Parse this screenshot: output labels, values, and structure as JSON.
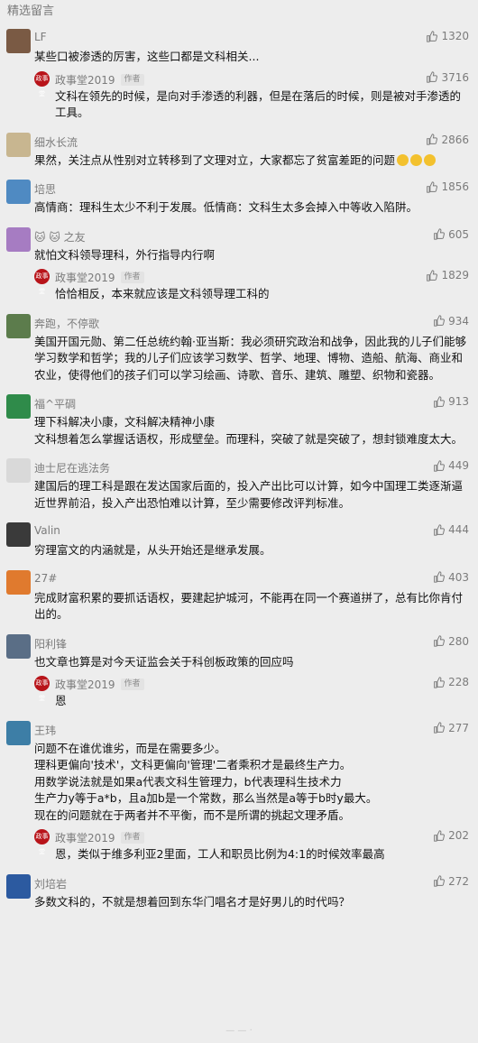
{
  "section_title": "精选留言",
  "comments": [
    {
      "nick": "LF",
      "likes": "1320",
      "text": "某些口被渗透的厉害，这些口都是文科相关...",
      "avatar_color": "#7a5a44",
      "reply": {
        "nick": "政事堂2019",
        "tag": "作者",
        "likes": "3716",
        "text": "文科在领先的时候，是向对手渗透的利器，但是在落后的时候，则是被对手渗透的工具。"
      }
    },
    {
      "nick": "细水长流",
      "likes": "2866",
      "text": "果然，关注点从性别对立转移到了文理对立，大家都忘了贫富差距的问题",
      "emojis": 3,
      "avatar_color": "#c8b690"
    },
    {
      "nick": "培思",
      "likes": "1856",
      "text": "高情商：理科生太少不利于发展。低情商：文科生太多会掉入中等收入陷阱。",
      "avatar_color": "#4f8ac2"
    },
    {
      "nick": "🐱 🐱 之友",
      "likes": "605",
      "text": "就怕文科领导理科，外行指导内行啊",
      "avatar_color": "#a67cc2",
      "reply": {
        "nick": "政事堂2019",
        "tag": "作者",
        "likes": "1829",
        "text": "恰恰相反，本来就应该是文科领导理工科的"
      }
    },
    {
      "nick": "奔跑，不停歌",
      "likes": "934",
      "text": "美国开国元勋、第二任总统约翰·亚当斯：我必须研究政治和战争，因此我的儿子们能够学习数学和哲学；我的儿子们应该学习数学、哲学、地理、博物、造船、航海、商业和农业，使得他们的孩子们可以学习绘画、诗歌、音乐、建筑、雕塑、织物和瓷器。",
      "avatar_color": "#5c7c4c"
    },
    {
      "nick": "福^平碉",
      "likes": "913",
      "text": "理下科解决小康，文科解决精神小康\n文科想着怎么掌握话语权，形成壁垒。而理科，突破了就是突破了，想封锁难度太大。",
      "avatar_color": "#2f8b4a"
    },
    {
      "nick": "迪士尼在逃法务",
      "likes": "449",
      "text": "建国后的理工科是跟在发达国家后面的，投入产出比可以计算，如今中国理工类逐渐逼近世界前沿，投入产出恐怕难以计算，至少需要修改评判标准。",
      "avatar_color": "#d9d9d9"
    },
    {
      "nick": "Valin",
      "likes": "444",
      "text": "穷理富文的内涵就是，从头开始还是继承发展。",
      "avatar_color": "#3a3a3a"
    },
    {
      "nick": "27#",
      "likes": "403",
      "text": "完成财富积累的要抓话语权，要建起护城河，不能再在同一个赛道拼了，总有比你肯付出的。",
      "avatar_color": "#e07a2e"
    },
    {
      "nick": "阳利锋",
      "likes": "280",
      "text": "也文章也算是对今天证监会关于科创板政策的回应吗",
      "avatar_color": "#5a6e86",
      "reply": {
        "nick": "政事堂2019",
        "tag": "作者",
        "likes": "228",
        "text": "恩"
      }
    },
    {
      "nick": "王玮",
      "likes": "277",
      "text": "问题不在谁优谁劣，而是在需要多少。\n理科更偏向'技术'，文科更偏向'管理'二者乘积才是最终生产力。\n用数学说法就是如果a代表文科生管理力，b代表理科生技术力\n生产力y等于a*b，且a加b是一个常数，那么当然是a等于b时y最大。\n现在的问题就在于两者并不平衡，而不是所谓的挑起文理矛盾。",
      "avatar_color": "#3d7ea6",
      "reply": {
        "nick": "政事堂2019",
        "tag": "作者",
        "likes": "202",
        "text": "恩，类似于维多利亚2里面，工人和职员比例为4:1的时候效率最高"
      }
    },
    {
      "nick": "刘培岩",
      "likes": "272",
      "text": "多数文科的，不就是想着回到东华门唱名才是好男儿的时代吗？",
      "avatar_color": "#2c5aa0"
    }
  ],
  "reply_logo_text": "政事堂",
  "bottom_indicator": "— — ·"
}
